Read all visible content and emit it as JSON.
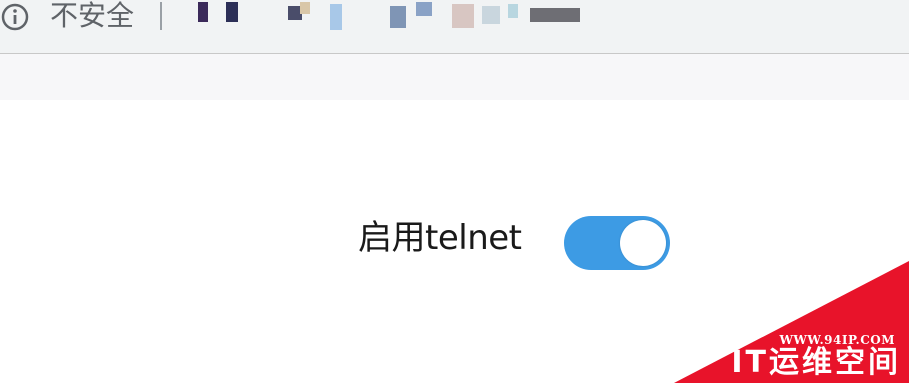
{
  "browser": {
    "security_label": "不安全",
    "info_icon": "info-circle-icon",
    "url_obscured": true
  },
  "setting": {
    "label": "启用telnet",
    "toggle_state": "on",
    "toggle_color": "#3d9be4"
  },
  "watermark": {
    "url": "WWW.94IP.COM",
    "name": "IT运维空间",
    "color": "#e8132a"
  }
}
